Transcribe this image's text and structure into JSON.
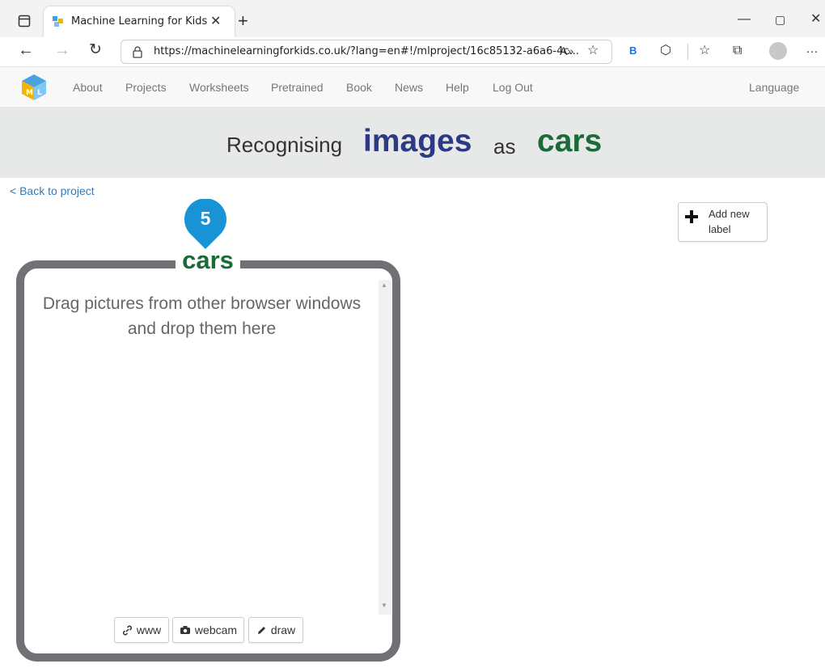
{
  "browser": {
    "tab_title": "Machine Learning for Kids",
    "url": "https://machinelearningforkids.co.uk/?lang=en#!/mlproject/16c85132-a6a6-4c...",
    "profile_letter": "B"
  },
  "site": {
    "logo_text": "ML",
    "nav": [
      "About",
      "Projects",
      "Worksheets",
      "Pretrained",
      "Book",
      "News",
      "Help",
      "Log Out"
    ],
    "language": "Language"
  },
  "banner": {
    "prefix": "Recognising",
    "type": "images",
    "connector": "as",
    "project": "cars"
  },
  "back_link": "< Back to project",
  "add_label_button": {
    "line1": "Add new",
    "line2": "label"
  },
  "bucket": {
    "count": "5",
    "label": "cars",
    "drop_text_1": "Drag pictures from other browser windows",
    "drop_text_2": "and drop them here",
    "buttons": {
      "www": "www",
      "webcam": "webcam",
      "draw": "draw"
    }
  },
  "colors": {
    "type": "#2b3a83",
    "project": "#1b6b38",
    "badge": "#1893d6",
    "bucket_border": "#6f7174",
    "link": "#337ab7"
  }
}
